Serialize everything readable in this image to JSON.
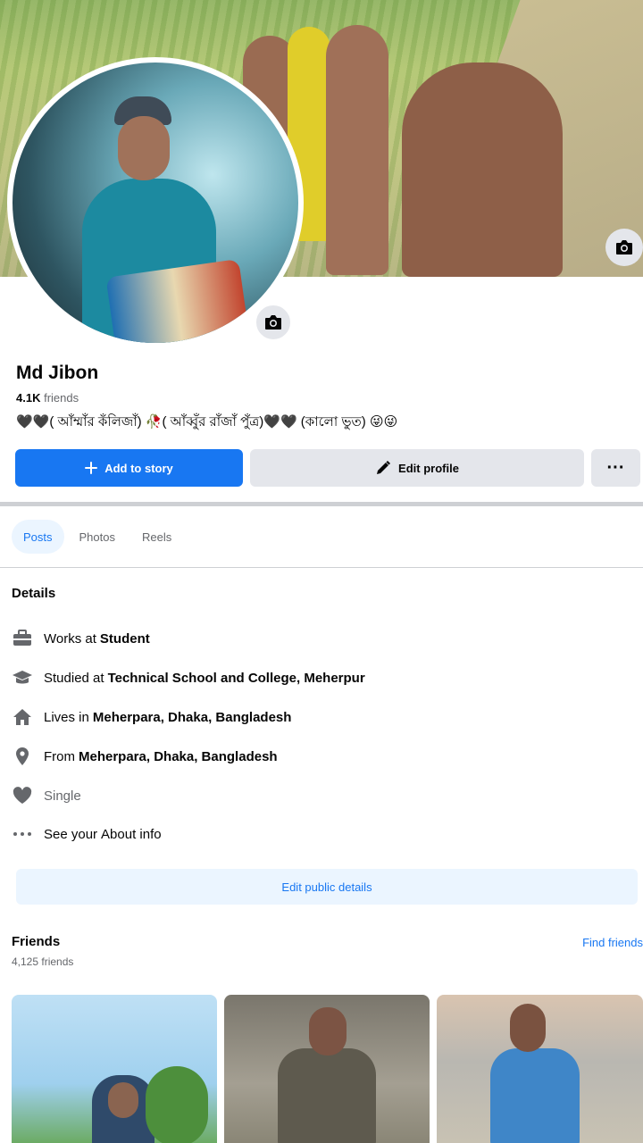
{
  "profile": {
    "name": "Md Jibon",
    "friends_count": "4.1K",
    "friends_word": "friends",
    "bio": "🖤🖤( আঁম্মাঁর কঁলিজাঁ) 🥀( আঁব্বুঁর রাঁজাঁ পুঁত্র)🖤🖤 (কালো ভুত) 😜😜"
  },
  "actions": {
    "add_story": "Add to story",
    "edit_profile": "Edit profile",
    "more": "···"
  },
  "tabs": [
    {
      "label": "Posts",
      "active": true
    },
    {
      "label": "Photos",
      "active": false
    },
    {
      "label": "Reels",
      "active": false
    }
  ],
  "details": {
    "title": "Details",
    "items": [
      {
        "icon": "briefcase-icon",
        "prefix": "Works at",
        "value": "Student"
      },
      {
        "icon": "graduation-cap-icon",
        "prefix": "Studied at",
        "value": "Technical School and College, Meherpur"
      },
      {
        "icon": "home-icon",
        "prefix": "Lives in",
        "value": "Meherpara, Dhaka, Bangladesh"
      },
      {
        "icon": "location-pin-icon",
        "prefix": "From",
        "value": "Meherpara, Dhaka, Bangladesh"
      },
      {
        "icon": "heart-icon",
        "prefix": "Single",
        "value": ""
      },
      {
        "icon": "more-dots-icon",
        "prefix": "See your",
        "value": "About info"
      }
    ],
    "edit_button": "Edit public details"
  },
  "friends": {
    "title": "Friends",
    "count": "4,125 friends",
    "find": "Find friends"
  },
  "colors": {
    "accent": "#1877f2",
    "accent_light": "#ebf5ff",
    "gray_button": "#e4e6eb",
    "secondary_text": "#65676b"
  }
}
